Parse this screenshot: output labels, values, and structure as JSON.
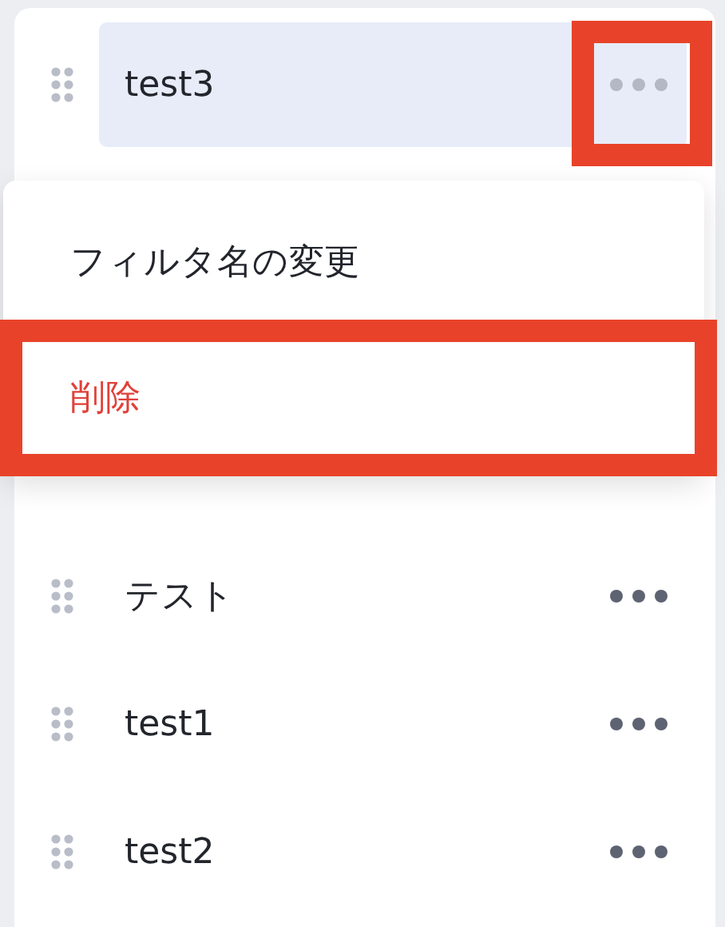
{
  "rows": [
    {
      "label": "test3",
      "selected": true,
      "highlighted": true
    },
    {
      "label": "テスト",
      "selected": false,
      "highlighted": false
    },
    {
      "label": "test1",
      "selected": false,
      "highlighted": false
    },
    {
      "label": "test2",
      "selected": false,
      "highlighted": false
    }
  ],
  "menu": {
    "items": [
      {
        "label": "フィルタ名の変更",
        "kind": "normal",
        "highlighted": false
      },
      {
        "label": "削除",
        "kind": "danger",
        "highlighted": true
      }
    ]
  }
}
